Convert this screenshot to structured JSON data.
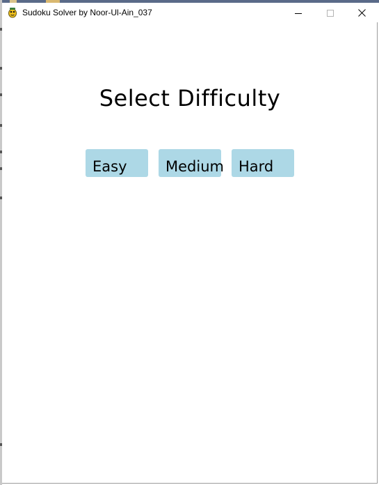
{
  "window": {
    "title": "Sudoku Solver by Noor-Ul-Ain_037",
    "app_icon": "pygame-snake-icon",
    "controls": {
      "minimize": "minimize-icon",
      "maximize": "maximize-icon",
      "close": "close-icon"
    }
  },
  "screen": {
    "heading": "Select Difficulty",
    "buttons": [
      {
        "label": "Easy"
      },
      {
        "label": "Medium"
      },
      {
        "label": "Hard"
      }
    ]
  },
  "colors": {
    "button_bg": "#add8e6",
    "background": "#ffffff",
    "text": "#000000"
  }
}
